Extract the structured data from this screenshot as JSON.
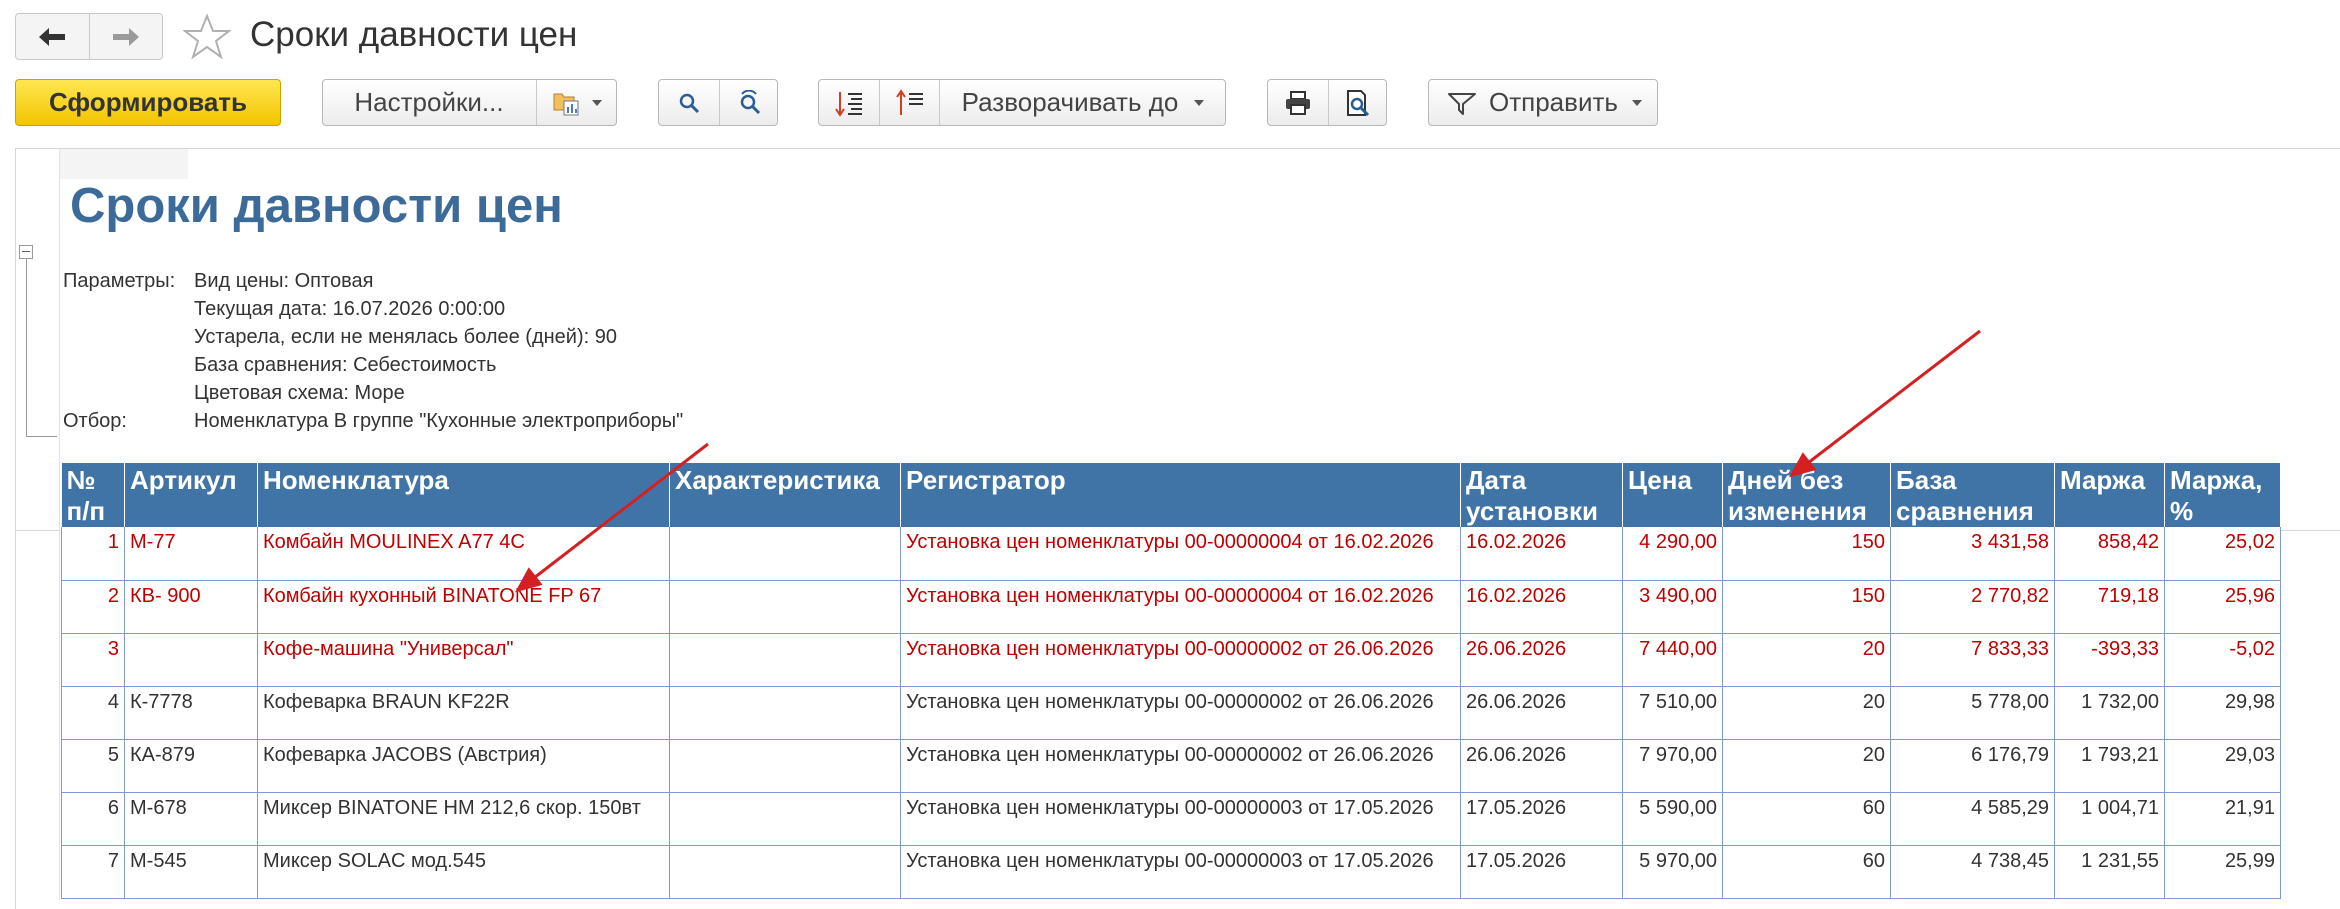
{
  "window": {
    "title": "Сроки давности цен"
  },
  "icons": {
    "back": "arrow-left-icon",
    "forward": "arrow-right-icon",
    "favorite": "star-icon"
  },
  "toolbar": {
    "generate_label": "Сформировать",
    "settings_label": "Настройки...",
    "expand_label": "Разворачивать до",
    "send_label": "Отправить"
  },
  "report": {
    "title": "Сроки давности цен",
    "params_label": "Параметры:",
    "params": [
      "Вид цены: Оптовая",
      "Текущая дата: 16.07.2026 0:00:00",
      "Устарела, если не менялась более (дней): 90",
      "База сравнения: Себестоимость",
      "Цветовая схема: Море"
    ],
    "filter_label": "Отбор:",
    "filter_value": "Номенклатура В группе \"Кухонные электроприборы\"",
    "columns": [
      "№ п/п",
      "Артикул",
      "Номенклатура",
      "Характеристика",
      "Регистратор",
      "Дата установки",
      "Цена",
      "Дней без изменения",
      "База сравнения",
      "Маржа",
      "Маржа, %"
    ],
    "rows": [
      {
        "n": "1",
        "art": "М-77",
        "name": "Комбайн MOULINEX  A77 4C",
        "char": "",
        "reg": "Установка цен номенклатуры 00-00000004 от 16.02.2026",
        "date": "16.02.2026",
        "price": "4 290,00",
        "days": "150",
        "base": "3 431,58",
        "margin": "858,42",
        "pct": "25,02",
        "stale": true
      },
      {
        "n": "2",
        "art": "КВ- 900",
        "name": "Комбайн кухонный BINATONE FP 67",
        "char": "",
        "reg": "Установка цен номенклатуры 00-00000004 от 16.02.2026",
        "date": "16.02.2026",
        "price": "3 490,00",
        "days": "150",
        "base": "2 770,82",
        "margin": "719,18",
        "pct": "25,96",
        "stale": true
      },
      {
        "n": "3",
        "art": "",
        "name": "Кофе-машина \"Универсал\"",
        "char": "",
        "reg": "Установка цен номенклатуры 00-00000002 от 26.06.2026",
        "date": "26.06.2026",
        "price": "7 440,00",
        "days": "20",
        "base": "7 833,33",
        "margin": "-393,33",
        "pct": "-5,02",
        "stale": true
      },
      {
        "n": "4",
        "art": "К-7778",
        "name": "Кофеварка BRAUN KF22R",
        "char": "",
        "reg": "Установка цен номенклатуры 00-00000002 от 26.06.2026",
        "date": "26.06.2026",
        "price": "7 510,00",
        "days": "20",
        "base": "5 778,00",
        "margin": "1 732,00",
        "pct": "29,98",
        "stale": false
      },
      {
        "n": "5",
        "art": "КА-879",
        "name": "Кофеварка JACOBS (Австрия)",
        "char": "",
        "reg": "Установка цен номенклатуры 00-00000002 от 26.06.2026",
        "date": "26.06.2026",
        "price": "7 970,00",
        "days": "20",
        "base": "6 176,79",
        "margin": "1 793,21",
        "pct": "29,03",
        "stale": false
      },
      {
        "n": "6",
        "art": "М-678",
        "name": "Миксер BINATONE HM 212,6 скор. 150вт",
        "char": "",
        "reg": "Установка цен номенклатуры 00-00000003 от 17.05.2026",
        "date": "17.05.2026",
        "price": "5 590,00",
        "days": "60",
        "base": "4 585,29",
        "margin": "1 004,71",
        "pct": "21,91",
        "stale": false
      },
      {
        "n": "7",
        "art": "М-545",
        "name": "Миксер SOLAC мод.545",
        "char": "",
        "reg": "Установка цен номенклатуры 00-00000003 от 17.05.2026",
        "date": "17.05.2026",
        "price": "5 970,00",
        "days": "60",
        "base": "4 738,45",
        "margin": "1 231,55",
        "pct": "25,99",
        "stale": false
      }
    ]
  },
  "colors": {
    "header_bg": "#4174a6",
    "title": "#3d6b99",
    "stale_text": "#c00000",
    "grid": "#7e9ad4",
    "arrow": "#d42020",
    "primary_button": "#f3c500"
  }
}
